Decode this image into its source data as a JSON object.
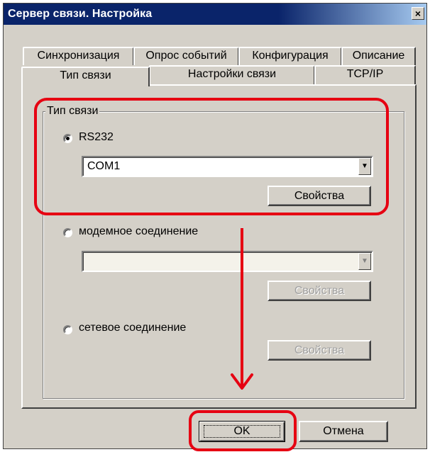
{
  "window": {
    "title": "Сервер связи. Настройка",
    "close_label": "×"
  },
  "tabs": {
    "back_row": [
      {
        "label": "Синхронизация"
      },
      {
        "label": "Опрос событий"
      },
      {
        "label": "Конфигурация"
      },
      {
        "label": "Описание"
      }
    ],
    "front_row": [
      {
        "label": "Тип связи",
        "selected": true
      },
      {
        "label": "Настройки связи"
      },
      {
        "label": "TCP/IP"
      }
    ]
  },
  "connection_type": {
    "group_label": "Тип связи",
    "options": [
      {
        "label": "RS232",
        "checked": true,
        "combo_value": "COM1",
        "properties_label": "Свойства",
        "enabled": true
      },
      {
        "label": "модемное соединение",
        "checked": false,
        "combo_value": "",
        "properties_label": "Свойства",
        "enabled": false
      },
      {
        "label": "сетевое соединение",
        "checked": false,
        "properties_label": "Свойства",
        "enabled": false
      }
    ]
  },
  "footer": {
    "ok_label": "OK",
    "cancel_label": "Отмена"
  },
  "annotation": {
    "color": "#e60012"
  }
}
